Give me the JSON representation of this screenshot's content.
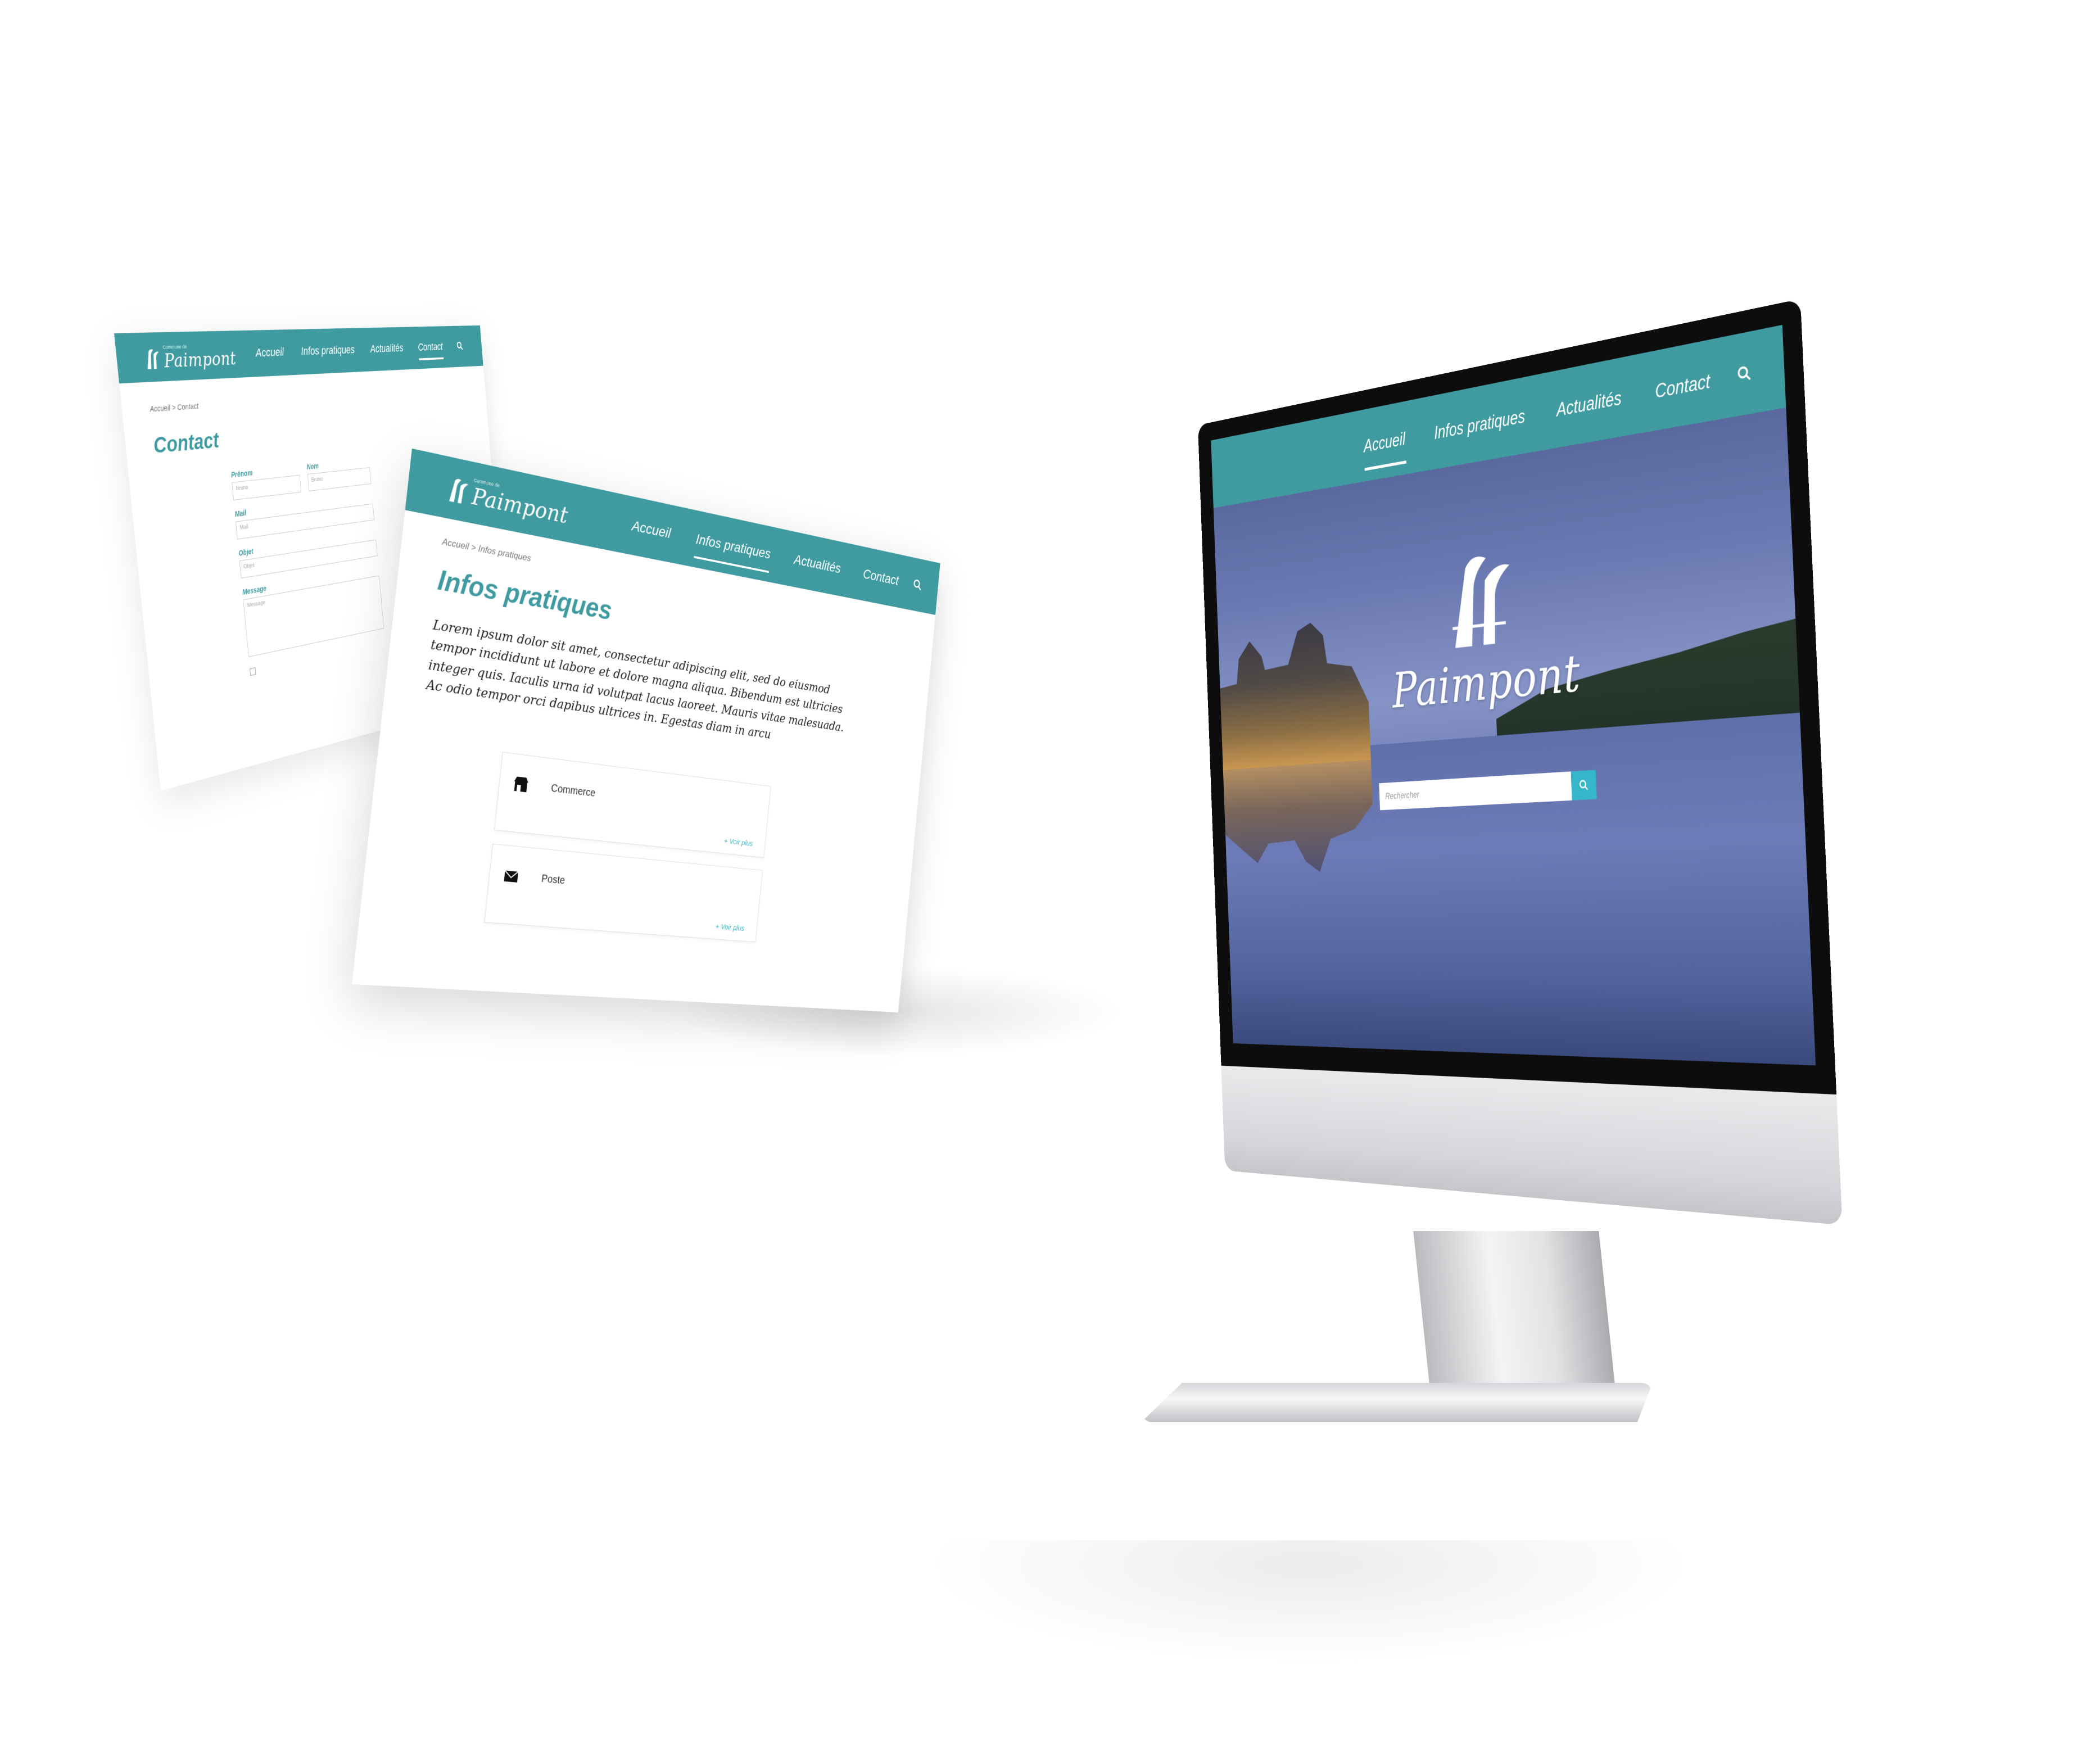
{
  "brand": {
    "name": "Paimpont",
    "tagline": "Commune de",
    "teal": "#3f9ba0",
    "accent": "#36b6c9"
  },
  "nav": {
    "items": [
      {
        "label": "Accueil"
      },
      {
        "label": "Infos pratiques"
      },
      {
        "label": "Actualités"
      },
      {
        "label": "Contact"
      }
    ],
    "search_icon": "search-icon"
  },
  "contact_page": {
    "breadcrumb": {
      "home": "Accueil",
      "sep": ">",
      "current": "Contact"
    },
    "title": "Contact",
    "form": {
      "prenom_label": "Prénom",
      "prenom_placeholder": "Bruno",
      "nom_label": "Nom",
      "nom_placeholder": "Bruno",
      "mail_label": "Mail",
      "mail_placeholder": "Mail",
      "objet_label": "Objet",
      "objet_placeholder": "Objet",
      "message_label": "Message",
      "message_placeholder": "Message"
    }
  },
  "infos_page": {
    "breadcrumb": {
      "home": "Accueil",
      "sep": ">",
      "current": "Infos pratiques"
    },
    "title": "Infos pratiques",
    "intro": "Lorem ipsum dolor sit amet, consectetur adipiscing elit, sed do eiusmod tempor incididunt ut labore et dolore magna aliqua. Bibendum est ultricies integer quis. Iaculis urna id volutpat lacus laoreet. Mauris vitae malesuada. Ac odio tempor orci dapibus ultrices in. Egestas diam in arcu",
    "cards": [
      {
        "label": "Commerce",
        "icon": "shop-icon",
        "more": "Voir plus"
      },
      {
        "label": "Poste",
        "icon": "envelope-icon",
        "more": "Voir plus"
      }
    ]
  },
  "home_page": {
    "hero_title": "Paimpont",
    "search_placeholder": "Rechercher",
    "search_button_icon": "search-icon"
  }
}
